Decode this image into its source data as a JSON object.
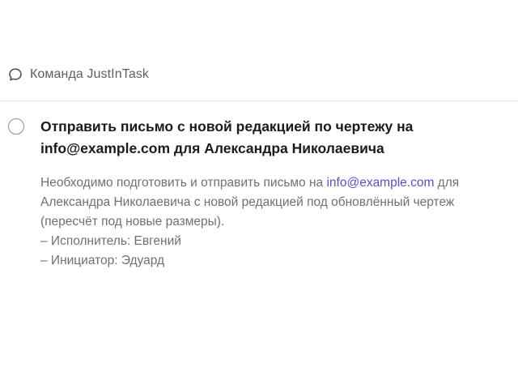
{
  "team": {
    "icon": "chat-bubble-icon",
    "name": "Команда JustInTask"
  },
  "task": {
    "completed": false,
    "title_line1": "Отправить письмо с новой редакцией по чертежу на",
    "title_email": "info@example.com",
    "title_rest": " для Александра Николаевича",
    "description": {
      "line1_prefix": "Необходимо подготовить и отправить письмо на ",
      "email": "info@example.com",
      "line1_suffix": " для",
      "line2": "Александра Николаевича с новой редакцией под обновлённый чертеж",
      "line3": "(пересчёт под новые размеры).",
      "line4": "– Исполнитель: Евгений",
      "line5": "– Инициатор: Эдуард"
    }
  },
  "colors": {
    "link": "#5b4fd1",
    "text_primary": "#1a1b1f",
    "text_secondary": "#6e7077",
    "divider": "#e3e3e6"
  }
}
